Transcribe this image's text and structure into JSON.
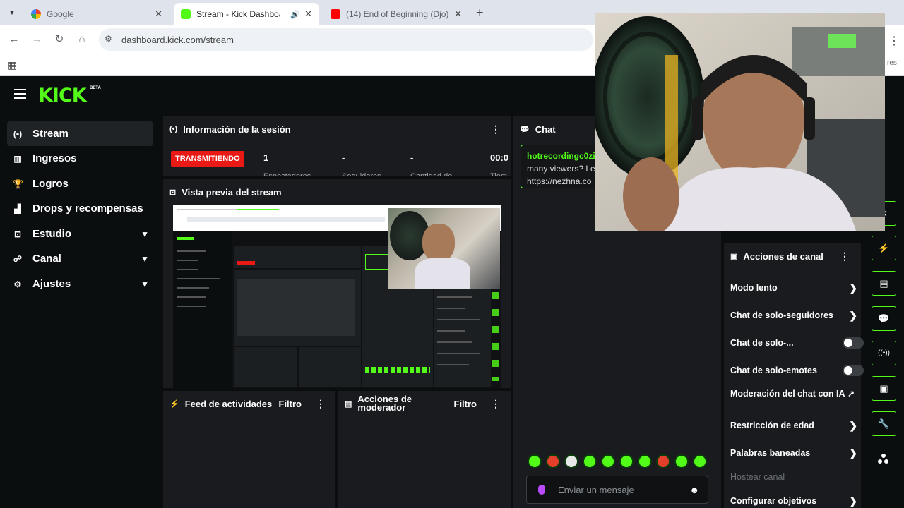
{
  "browser": {
    "tabs": [
      {
        "title": "Google",
        "active": false
      },
      {
        "title": "Stream - Kick Dashboard",
        "active": true
      },
      {
        "title": "(14) End of Beginning (Djo) x M",
        "active": false
      }
    ],
    "url": "dashboard.kick.com/stream",
    "close_glyph": "✕",
    "new_tab_glyph": "+",
    "truncated_right_text": "res"
  },
  "brand": {
    "logo": "KICK",
    "badge": "BETA",
    "accent": "#53fc18"
  },
  "sidebar": {
    "items": [
      {
        "label": "Stream",
        "icon": "broadcast-icon",
        "glyph": "(•)",
        "active": true
      },
      {
        "label": "Ingresos",
        "icon": "chart-icon",
        "glyph": "▥"
      },
      {
        "label": "Logros",
        "icon": "trophy-icon",
        "glyph": "🏆"
      },
      {
        "label": "Drops y recompensas",
        "icon": "drops-icon",
        "glyph": "▟"
      },
      {
        "label": "Estudio",
        "icon": "studio-icon",
        "glyph": "⊡",
        "expandable": true
      },
      {
        "label": "Canal",
        "icon": "channel-icon",
        "glyph": "☍",
        "expandable": true
      },
      {
        "label": "Ajustes",
        "icon": "settings-icon",
        "glyph": "⚙",
        "expandable": true
      }
    ]
  },
  "session": {
    "title": "Información de la sesión",
    "status": "TRANSMITIENDO",
    "stats": [
      {
        "value": "1",
        "label": "Espectadores"
      },
      {
        "value": "-",
        "label": "Seguidores"
      },
      {
        "value": "-",
        "label": "Cantidad de"
      },
      {
        "value": "00:0",
        "label": "Tiem"
      }
    ]
  },
  "preview": {
    "title": "Vista previa del stream"
  },
  "activity": {
    "title": "Feed de actividades",
    "filter": "Filtro"
  },
  "moderator": {
    "title_line1": "Acciones de",
    "title_line2": "moderador",
    "filter": "Filtro"
  },
  "chat": {
    "title": "Chat",
    "message": {
      "user": "hotrecordingc0zi",
      "line1": "many viewers? Le",
      "line2": "https://nezhna.co"
    },
    "placeholder": "Enviar un mensaje"
  },
  "channel_actions": {
    "title": "Acciones de canal",
    "rows": [
      {
        "label": "Modo lento",
        "control": "chevron"
      },
      {
        "label": "Chat de solo-seguidores",
        "control": "chevron"
      },
      {
        "label": "Chat de solo-...",
        "control": "toggle",
        "on": false
      },
      {
        "label": "Chat de solo-emotes",
        "control": "toggle",
        "on": false
      },
      {
        "label": "Moderación del chat con IA",
        "control": "external"
      },
      {
        "label": "Restricción de edad",
        "control": "chevron"
      },
      {
        "label": "Palabras baneadas",
        "control": "chevron"
      },
      {
        "label": "Hostear canal",
        "control": "none",
        "disabled": true
      },
      {
        "label": "Configurar objetivos",
        "control": "chevron"
      }
    ]
  },
  "quick_actions": [
    {
      "icon": "lightning-icon",
      "glyph": "⚡"
    },
    {
      "icon": "note-icon",
      "glyph": "▤"
    },
    {
      "icon": "chat-bubble-icon",
      "glyph": "💬"
    },
    {
      "icon": "broadcast-icon",
      "glyph": "((•))"
    },
    {
      "icon": "camera-switch-icon",
      "glyph": "▣"
    },
    {
      "icon": "wrench-icon",
      "glyph": "🔧"
    }
  ],
  "more_glyph": "⋮"
}
